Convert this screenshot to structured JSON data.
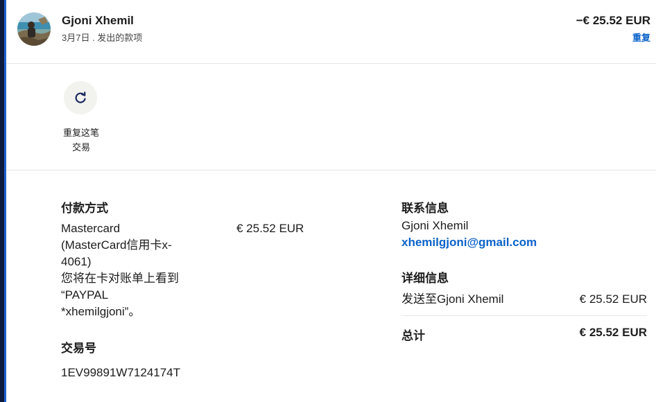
{
  "header": {
    "name": "Gjoni Xhemil",
    "subtitle": "3月7日 . 发出的款项",
    "amount": "−€ 25.52 EUR",
    "repeat_link": "重复"
  },
  "actions": {
    "repeat_label": "重复这笔\n交易"
  },
  "payment": {
    "title": "付款方式",
    "method_text": "Mastercard\n(MasterCard信用卡x-\n4061)\n您将在卡对账单上看到\n“PAYPAL\n*xhemilgjoni”。",
    "amount": "€ 25.52 EUR"
  },
  "transaction": {
    "title": "交易号",
    "id": "1EV99891W7124174T"
  },
  "contact": {
    "title": "联系信息",
    "name": "Gjoni Xhemil",
    "email": "xhemilgjoni@gmail.com"
  },
  "details": {
    "title": "详细信息",
    "row_label": "发送至Gjoni Xhemil",
    "row_amount": "€ 25.52 EUR",
    "total_label": "总计",
    "total_amount": "€ 25.52 EUR"
  },
  "colors": {
    "link": "#0a62c9",
    "accent": "#1f5fd0"
  },
  "icons": {
    "repeat": "refresh-icon"
  }
}
